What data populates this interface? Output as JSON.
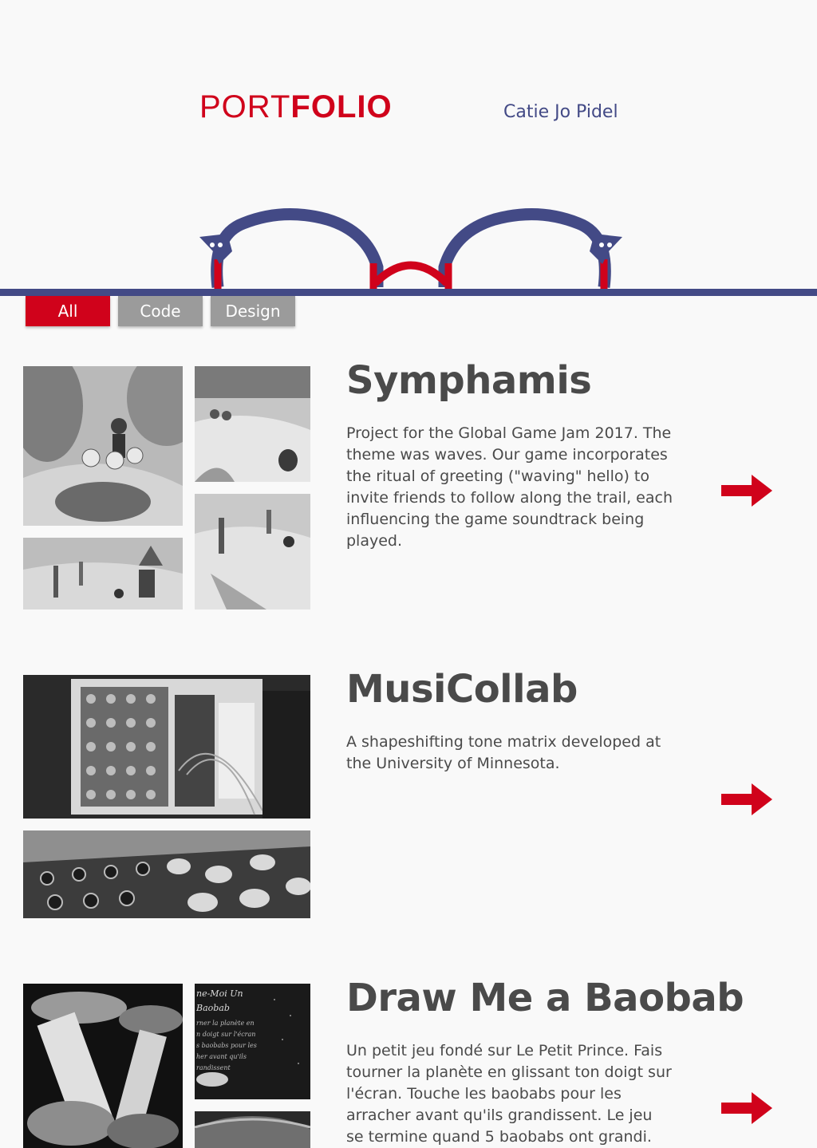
{
  "header": {
    "logo_prefix": "PORT",
    "logo_suffix": "FOLIO",
    "author": "Catie Jo Pidel"
  },
  "colors": {
    "accent": "#d0021b",
    "navy": "#434a86",
    "text": "#4a4a4a",
    "inactive": "#9b9b9b"
  },
  "filters": [
    {
      "label": "All",
      "active": true
    },
    {
      "label": "Code",
      "active": false
    },
    {
      "label": "Design",
      "active": false
    }
  ],
  "projects": [
    {
      "title": "Symphamis",
      "description": "Project for the Global Game Jam 2017. The theme was waves. Our game incorporates the ritual of greeting (\"waving\" hello) to invite friends to follow along the trail, each influencing the game soundtrack being played.",
      "link_icon": "arrow-right-icon"
    },
    {
      "title": "MusiCollab",
      "description": "A shapeshifting tone matrix developed at the University of Minnesota.",
      "link_icon": "arrow-right-icon"
    },
    {
      "title": "Draw Me a Baobab",
      "description": "Un petit jeu fondé sur Le Petit Prince. Fais tourner la planète en glissant ton doigt sur l'écran. Touche les baobabs pour les arracher avant qu'ils grandissent. Le jeu se termine quand 5 baobabs ont grandi.",
      "link_icon": "arrow-right-icon"
    }
  ]
}
